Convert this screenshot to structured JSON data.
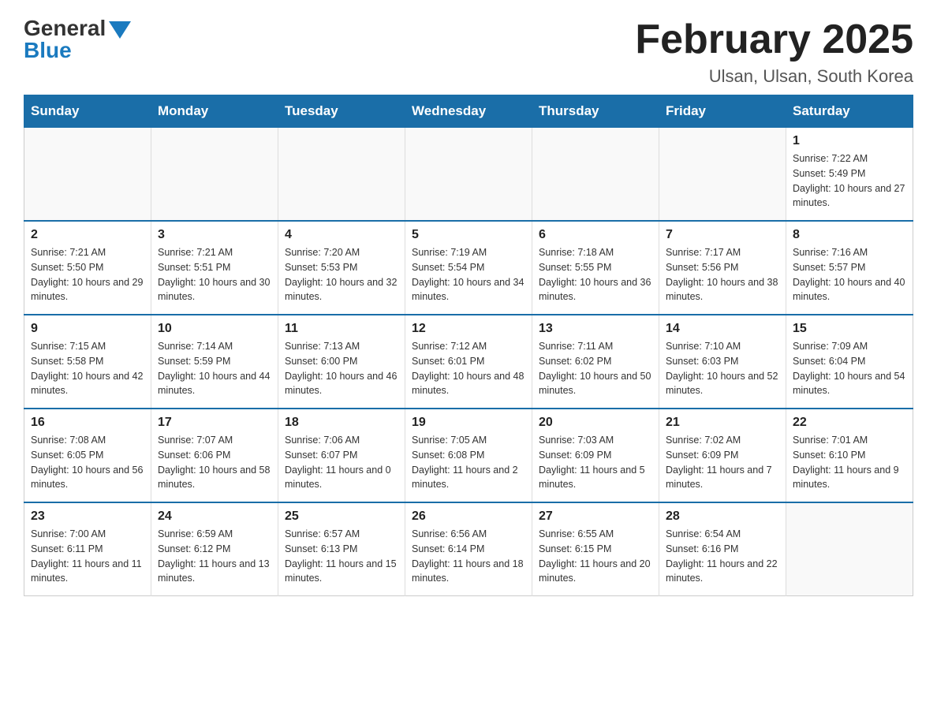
{
  "header": {
    "logo": {
      "general": "General",
      "blue": "Blue"
    },
    "title": "February 2025",
    "location": "Ulsan, Ulsan, South Korea"
  },
  "days_of_week": [
    "Sunday",
    "Monday",
    "Tuesday",
    "Wednesday",
    "Thursday",
    "Friday",
    "Saturday"
  ],
  "weeks": [
    [
      {
        "day": "",
        "info": ""
      },
      {
        "day": "",
        "info": ""
      },
      {
        "day": "",
        "info": ""
      },
      {
        "day": "",
        "info": ""
      },
      {
        "day": "",
        "info": ""
      },
      {
        "day": "",
        "info": ""
      },
      {
        "day": "1",
        "info": "Sunrise: 7:22 AM\nSunset: 5:49 PM\nDaylight: 10 hours and 27 minutes."
      }
    ],
    [
      {
        "day": "2",
        "info": "Sunrise: 7:21 AM\nSunset: 5:50 PM\nDaylight: 10 hours and 29 minutes."
      },
      {
        "day": "3",
        "info": "Sunrise: 7:21 AM\nSunset: 5:51 PM\nDaylight: 10 hours and 30 minutes."
      },
      {
        "day": "4",
        "info": "Sunrise: 7:20 AM\nSunset: 5:53 PM\nDaylight: 10 hours and 32 minutes."
      },
      {
        "day": "5",
        "info": "Sunrise: 7:19 AM\nSunset: 5:54 PM\nDaylight: 10 hours and 34 minutes."
      },
      {
        "day": "6",
        "info": "Sunrise: 7:18 AM\nSunset: 5:55 PM\nDaylight: 10 hours and 36 minutes."
      },
      {
        "day": "7",
        "info": "Sunrise: 7:17 AM\nSunset: 5:56 PM\nDaylight: 10 hours and 38 minutes."
      },
      {
        "day": "8",
        "info": "Sunrise: 7:16 AM\nSunset: 5:57 PM\nDaylight: 10 hours and 40 minutes."
      }
    ],
    [
      {
        "day": "9",
        "info": "Sunrise: 7:15 AM\nSunset: 5:58 PM\nDaylight: 10 hours and 42 minutes."
      },
      {
        "day": "10",
        "info": "Sunrise: 7:14 AM\nSunset: 5:59 PM\nDaylight: 10 hours and 44 minutes."
      },
      {
        "day": "11",
        "info": "Sunrise: 7:13 AM\nSunset: 6:00 PM\nDaylight: 10 hours and 46 minutes."
      },
      {
        "day": "12",
        "info": "Sunrise: 7:12 AM\nSunset: 6:01 PM\nDaylight: 10 hours and 48 minutes."
      },
      {
        "day": "13",
        "info": "Sunrise: 7:11 AM\nSunset: 6:02 PM\nDaylight: 10 hours and 50 minutes."
      },
      {
        "day": "14",
        "info": "Sunrise: 7:10 AM\nSunset: 6:03 PM\nDaylight: 10 hours and 52 minutes."
      },
      {
        "day": "15",
        "info": "Sunrise: 7:09 AM\nSunset: 6:04 PM\nDaylight: 10 hours and 54 minutes."
      }
    ],
    [
      {
        "day": "16",
        "info": "Sunrise: 7:08 AM\nSunset: 6:05 PM\nDaylight: 10 hours and 56 minutes."
      },
      {
        "day": "17",
        "info": "Sunrise: 7:07 AM\nSunset: 6:06 PM\nDaylight: 10 hours and 58 minutes."
      },
      {
        "day": "18",
        "info": "Sunrise: 7:06 AM\nSunset: 6:07 PM\nDaylight: 11 hours and 0 minutes."
      },
      {
        "day": "19",
        "info": "Sunrise: 7:05 AM\nSunset: 6:08 PM\nDaylight: 11 hours and 2 minutes."
      },
      {
        "day": "20",
        "info": "Sunrise: 7:03 AM\nSunset: 6:09 PM\nDaylight: 11 hours and 5 minutes."
      },
      {
        "day": "21",
        "info": "Sunrise: 7:02 AM\nSunset: 6:09 PM\nDaylight: 11 hours and 7 minutes."
      },
      {
        "day": "22",
        "info": "Sunrise: 7:01 AM\nSunset: 6:10 PM\nDaylight: 11 hours and 9 minutes."
      }
    ],
    [
      {
        "day": "23",
        "info": "Sunrise: 7:00 AM\nSunset: 6:11 PM\nDaylight: 11 hours and 11 minutes."
      },
      {
        "day": "24",
        "info": "Sunrise: 6:59 AM\nSunset: 6:12 PM\nDaylight: 11 hours and 13 minutes."
      },
      {
        "day": "25",
        "info": "Sunrise: 6:57 AM\nSunset: 6:13 PM\nDaylight: 11 hours and 15 minutes."
      },
      {
        "day": "26",
        "info": "Sunrise: 6:56 AM\nSunset: 6:14 PM\nDaylight: 11 hours and 18 minutes."
      },
      {
        "day": "27",
        "info": "Sunrise: 6:55 AM\nSunset: 6:15 PM\nDaylight: 11 hours and 20 minutes."
      },
      {
        "day": "28",
        "info": "Sunrise: 6:54 AM\nSunset: 6:16 PM\nDaylight: 11 hours and 22 minutes."
      },
      {
        "day": "",
        "info": ""
      }
    ]
  ]
}
